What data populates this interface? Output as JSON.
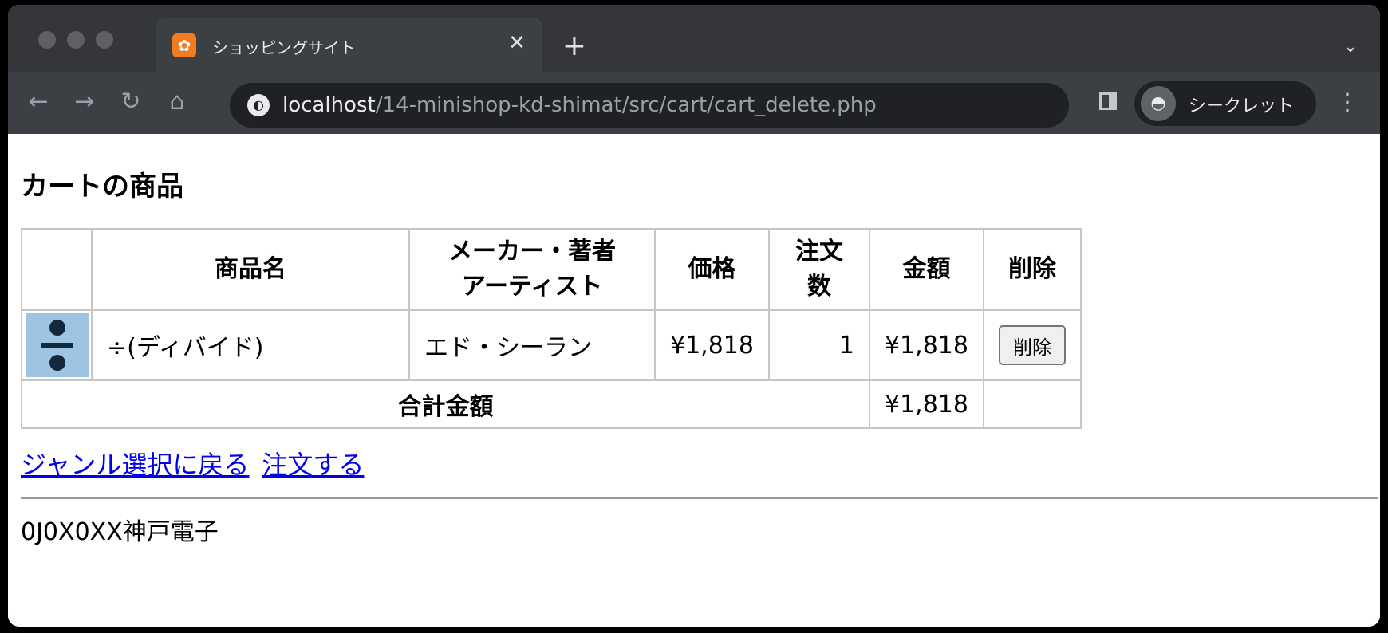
{
  "browser": {
    "tab_title": "ショッピングサイト",
    "url_host": "localhost",
    "url_path": "/14-minishop-kd-shimat/src/cart/cart_delete.php",
    "incognito_label": "シークレット"
  },
  "page": {
    "title": "カートの商品",
    "table": {
      "headers": {
        "name": "商品名",
        "maker_line1": "メーカー・著者",
        "maker_line2": "アーティスト",
        "price": "価格",
        "quantity": "注文数",
        "amount": "金額",
        "delete": "削除"
      },
      "rows": [
        {
          "name": "÷(ディバイド)",
          "maker": "エド・シーラン",
          "price": "¥1,818",
          "quantity": "1",
          "amount": "¥1,818",
          "delete_label": "削除"
        }
      ],
      "total_label": "合計金額",
      "total_amount": "¥1,818"
    },
    "links": {
      "back": "ジャンル選択に戻る",
      "order": "注文する"
    },
    "footer": "0J0X0XX神戸電子"
  }
}
